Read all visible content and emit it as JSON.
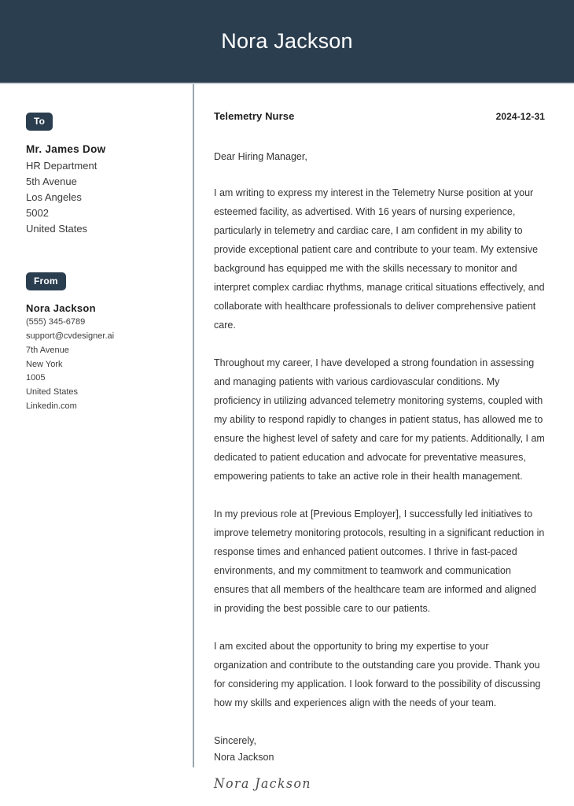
{
  "header": {
    "name": "Nora Jackson"
  },
  "sidebar": {
    "to": {
      "badge_label": "To",
      "name": "Mr. James Dow",
      "lines": [
        "HR Department",
        "5th Avenue",
        "Los Angeles",
        "5002",
        "United States"
      ]
    },
    "from": {
      "badge_label": "From",
      "name": "Nora Jackson",
      "lines": [
        "(555) 345-6789",
        "support@cvdesigner.ai",
        "7th Avenue",
        "New York",
        "1005",
        "United States",
        "Linkedin.com"
      ]
    }
  },
  "letter": {
    "job_title": "Telemetry Nurse",
    "date": "2024-12-31",
    "salutation": "Dear Hiring Manager,",
    "paragraphs": [
      "I am writing to express my interest in the Telemetry Nurse position at your esteemed facility, as advertised. With 16 years of nursing experience, particularly in telemetry and cardiac care, I am confident in my ability to provide exceptional patient care and contribute to your team. My extensive background has equipped me with the skills necessary to monitor and interpret complex cardiac rhythms, manage critical situations effectively, and collaborate with healthcare professionals to deliver comprehensive patient care.",
      "Throughout my career, I have developed a strong foundation in assessing and managing patients with various cardiovascular conditions. My proficiency in utilizing advanced telemetry monitoring systems, coupled with my ability to respond rapidly to changes in patient status, has allowed me to ensure the highest level of safety and care for my patients. Additionally, I am dedicated to patient education and advocate for preventative measures, empowering patients to take an active role in their health management.",
      "In my previous role at [Previous Employer], I successfully led initiatives to improve telemetry monitoring protocols, resulting in a significant reduction in response times and enhanced patient outcomes. I thrive in fast-paced environments, and my commitment to teamwork and communication ensures that all members of the healthcare team are informed and aligned in providing the best possible care to our patients.",
      "I am excited about the opportunity to bring my expertise to your organization and contribute to the outstanding care you provide. Thank you for considering my application. I look forward to the possibility of discussing how my skills and experiences align with the needs of your team."
    ],
    "closing_word": "Sincerely,",
    "closing_name": "Nora Jackson",
    "signature": "Nora Jackson"
  },
  "colors": {
    "header_background": "#2b3e50",
    "badge_background": "#2b3e50",
    "divider": "#9aa7b0",
    "body_text": "#333333"
  }
}
